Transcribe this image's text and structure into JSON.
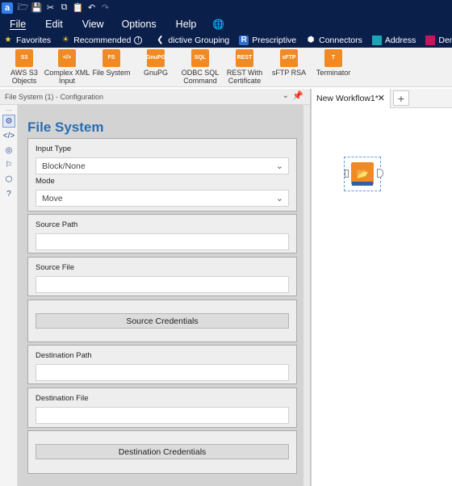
{
  "app": {
    "logo_letter": "a"
  },
  "menu": [
    "File",
    "Edit",
    "View",
    "Options",
    "Help"
  ],
  "categories": [
    {
      "label": "Favorites",
      "icon": "star-icon"
    },
    {
      "label": "Recommended",
      "icon": "bulb-icon"
    },
    {
      "label": "dictive Grouping",
      "icon": "chevron-left-icon"
    },
    {
      "label": "Prescriptive",
      "icon": "r-icon"
    },
    {
      "label": "Connectors",
      "icon": "hexagon-icon"
    },
    {
      "label": "Address",
      "icon": "address-icon"
    },
    {
      "label": "Demographic Analysis",
      "icon": "demographic-icon"
    }
  ],
  "tools": [
    {
      "label": "AWS S3 Objects",
      "badge": "S3"
    },
    {
      "label": "Complex XML Input",
      "badge": "</>"
    },
    {
      "label": "File System",
      "badge": "FS"
    },
    {
      "label": "GnuPG",
      "badge": "GnuPG"
    },
    {
      "label": "ODBC SQL Command",
      "badge": "SQL"
    },
    {
      "label": "REST With Certificate",
      "badge": "REST"
    },
    {
      "label": "sFTP RSA",
      "badge": "sFTP"
    },
    {
      "label": "Terminator",
      "badge": "T"
    }
  ],
  "config": {
    "header": "File System (1) - Configuration",
    "title": "File System",
    "input_type_label": "Input Type",
    "input_type_value": "Block/None",
    "mode_label": "Mode",
    "mode_value": "Move",
    "source_path_label": "Source Path",
    "source_path_value": "",
    "source_file_label": "Source File",
    "source_file_value": "",
    "source_credentials": "Source Credentials",
    "dest_path_label": "Destination Path",
    "dest_path_value": "",
    "dest_file_label": "Destination File",
    "dest_file_value": "",
    "dest_credentials": "Destination Credentials"
  },
  "workflow": {
    "tab_label": "New Workflow1*",
    "close": "✕",
    "add": "+"
  },
  "colors": {
    "topbar": "#0b1f4b",
    "accent": "#2a6db0",
    "tool_orange": "#f08a24"
  }
}
